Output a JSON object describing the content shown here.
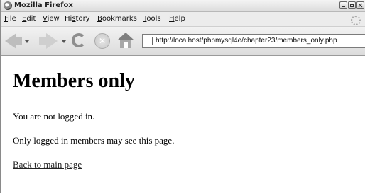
{
  "window": {
    "title": "Mozilla Firefox"
  },
  "menu": {
    "items": [
      {
        "key": "F",
        "rest": "ile"
      },
      {
        "key": "E",
        "rest": "dit"
      },
      {
        "key": "V",
        "rest": "iew"
      },
      {
        "pre": "Hi",
        "key": "s",
        "rest": "tory"
      },
      {
        "key": "B",
        "rest": "ookmarks"
      },
      {
        "key": "T",
        "rest": "ools"
      },
      {
        "key": "H",
        "rest": "elp"
      }
    ]
  },
  "toolbar": {
    "address": "http://localhost/phpmysql4e/chapter23/members_only.php",
    "stop_glyph": "✕"
  },
  "content": {
    "heading": "Members only",
    "line1": "You are not logged in.",
    "line2": "Only logged in members may see this page.",
    "link": "Back to main page"
  }
}
